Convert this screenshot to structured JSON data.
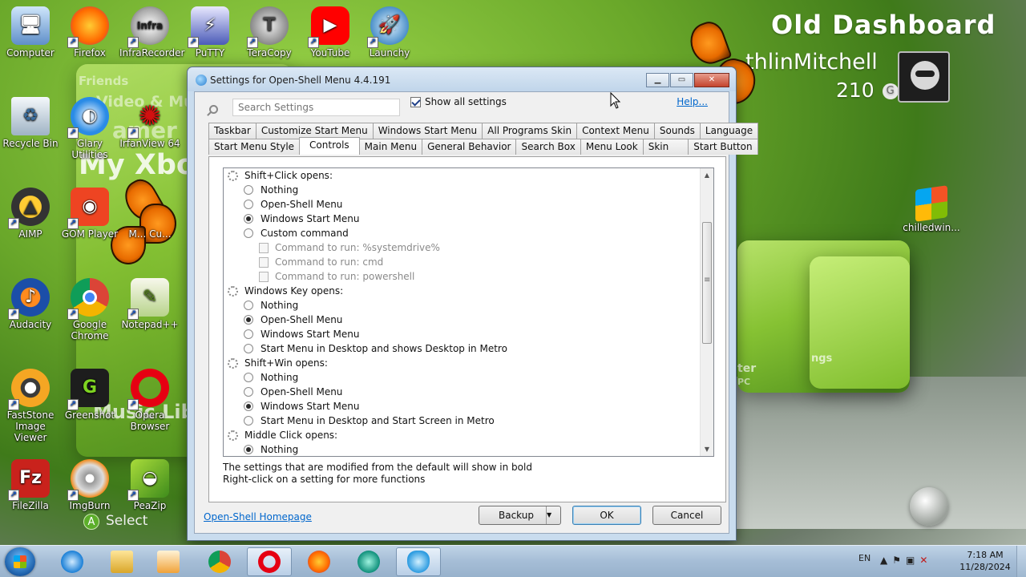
{
  "wallpaper": {
    "title": "Old Dashboard",
    "gamertag": "thlinMitchell",
    "gamerscore": "210",
    "gamerscore_glyph": "G",
    "select_label": "Select",
    "select_button": "A",
    "bg_texts": [
      "Friends",
      "Video & Music",
      "amer",
      "My Xbo",
      "Music Libr",
      "ter",
      "ngs",
      "PC"
    ]
  },
  "desktop_icons": [
    {
      "label": "Computer"
    },
    {
      "label": "Firefox"
    },
    {
      "label": "InfraRecorder"
    },
    {
      "label": "PuTTY"
    },
    {
      "label": "TeraCopy"
    },
    {
      "label": "YouTube"
    },
    {
      "label": "Launchy"
    },
    {
      "label": "Recycle Bin"
    },
    {
      "label": "Glary Utilities"
    },
    {
      "label": "IrfanView 64"
    },
    {
      "label": "AIMP"
    },
    {
      "label": "GOM Player"
    },
    {
      "label": "M... Cu..."
    },
    {
      "label": "Audacity"
    },
    {
      "label": "Google Chrome"
    },
    {
      "label": "Notepad++"
    },
    {
      "label": "FastStone Image Viewer"
    },
    {
      "label": "Greenshot"
    },
    {
      "label": "Opera Browser"
    },
    {
      "label": "FileZilla"
    },
    {
      "label": "ImgBurn"
    },
    {
      "label": "PeaZip"
    },
    {
      "label": "chilledwin..."
    }
  ],
  "window": {
    "title": "Settings for Open-Shell Menu 4.4.191",
    "caption": {
      "minimize": "▁",
      "maximize": "▭",
      "close": "✕"
    },
    "search_placeholder": "Search Settings",
    "show_all_label": "Show all settings",
    "show_all_checked": true,
    "help_label": "Help...",
    "tabs_row1": [
      "Taskbar",
      "Customize Start Menu",
      "Windows Start Menu",
      "All Programs Skin",
      "Context Menu",
      "Sounds",
      "Language"
    ],
    "tabs_row2": [
      "Start Menu Style",
      "Controls",
      "Main Menu",
      "General Behavior",
      "Search Box",
      "Menu Look",
      "Skin",
      "Start Button"
    ],
    "active_tab": "Controls",
    "tree": [
      {
        "label": "Shift+Click opens:",
        "type": "group"
      },
      {
        "label": "Nothing",
        "type": "radio",
        "selected": false
      },
      {
        "label": "Open-Shell Menu",
        "type": "radio",
        "selected": false
      },
      {
        "label": "Windows Start Menu",
        "type": "radio",
        "selected": true
      },
      {
        "label": "Custom command",
        "type": "radio",
        "selected": false
      },
      {
        "label": "Command to run: %systemdrive%",
        "type": "command"
      },
      {
        "label": "Command to run: cmd",
        "type": "command"
      },
      {
        "label": "Command to run: powershell",
        "type": "command"
      },
      {
        "label": "Windows Key opens:",
        "type": "group"
      },
      {
        "label": "Nothing",
        "type": "radio",
        "selected": false
      },
      {
        "label": "Open-Shell Menu",
        "type": "radio",
        "selected": true
      },
      {
        "label": "Windows Start Menu",
        "type": "radio",
        "selected": false
      },
      {
        "label": "Start Menu in Desktop and shows Desktop in Metro",
        "type": "radio",
        "selected": false
      },
      {
        "label": "Shift+Win opens:",
        "type": "group"
      },
      {
        "label": "Nothing",
        "type": "radio",
        "selected": false
      },
      {
        "label": "Open-Shell Menu",
        "type": "radio",
        "selected": false
      },
      {
        "label": "Windows Start Menu",
        "type": "radio",
        "selected": true
      },
      {
        "label": "Start Menu in Desktop and Start Screen in Metro",
        "type": "radio",
        "selected": false
      },
      {
        "label": "Middle Click opens:",
        "type": "group"
      },
      {
        "label": "Nothing",
        "type": "radio",
        "selected": true
      }
    ],
    "info_line1": "The settings that are modified from the default will show in bold",
    "info_line2": "Right-click on a setting for more functions",
    "homepage_link": "Open-Shell Homepage",
    "backup_button": "Backup",
    "ok_button": "OK",
    "cancel_button": "Cancel"
  },
  "taskbar": {
    "apps": [
      "internet-explorer",
      "file-explorer",
      "media-player",
      "google-chrome",
      "opera",
      "firefox",
      "app-teal",
      "open-shell-settings"
    ],
    "language": "EN",
    "time": "7:18 AM",
    "date": "11/28/2024"
  }
}
